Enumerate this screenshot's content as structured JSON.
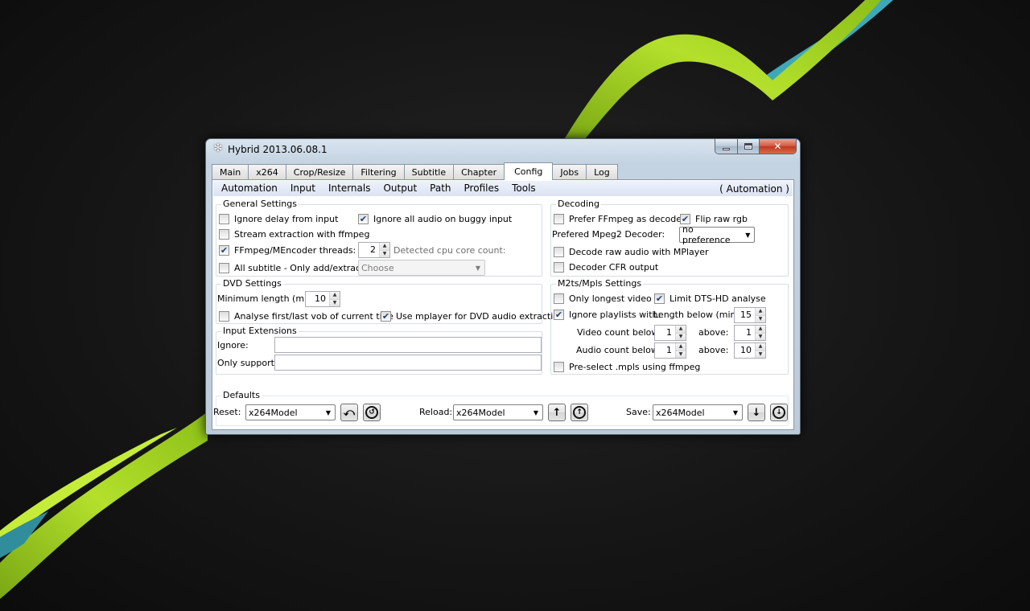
{
  "window": {
    "title": "Hybrid 2013.06.08.1"
  },
  "tabs": [
    {
      "label": "Main"
    },
    {
      "label": "x264"
    },
    {
      "label": "Crop/Resize"
    },
    {
      "label": "Filtering"
    },
    {
      "label": "Subtitle"
    },
    {
      "label": "Chapter"
    },
    {
      "label": "Config",
      "active": true
    },
    {
      "label": "Jobs"
    },
    {
      "label": "Log"
    }
  ],
  "submenu": {
    "items": [
      "Automation",
      "Input",
      "Internals",
      "Output",
      "Path",
      "Profiles",
      "Tools"
    ],
    "current": "( Automation )"
  },
  "general": {
    "title": "General Settings",
    "ignore_delay": {
      "label": "Ignore delay from input",
      "checked": false
    },
    "ignore_audio": {
      "label": "Ignore all audio on buggy input",
      "checked": true
    },
    "stream_extraction": {
      "label": "Stream extraction with ffmpeg",
      "checked": false
    },
    "threads": {
      "label": "FFmpeg/MEncoder threads:",
      "checked": true,
      "value": "2"
    },
    "cpu_cores_label": "Detected cpu core count:",
    "all_subtitle": {
      "label": "All subtitle - Only add/extract:",
      "checked": false,
      "selected": "Choose"
    }
  },
  "decoding": {
    "title": "Decoding",
    "prefer_ffmpeg": {
      "label": "Prefer FFmpeg as decoder",
      "checked": false
    },
    "flip_raw_rgb": {
      "label": "Flip raw rgb",
      "checked": true
    },
    "mpeg2_label": "Prefered Mpeg2 Decoder:",
    "mpeg2_value": "no preference",
    "decode_raw_audio": {
      "label": "Decode raw audio with MPlayer",
      "checked": false
    },
    "decoder_cfr": {
      "label": "Decoder CFR output",
      "checked": false
    }
  },
  "dvd": {
    "title": "DVD Settings",
    "min_length_label": "Minimum length (min):",
    "min_length_value": "10",
    "analyse_vob": {
      "label": "Analyse first/last vob of current title",
      "checked": false
    },
    "use_mplayer": {
      "label": "Use mplayer for DVD audio extraction",
      "checked": true
    }
  },
  "input_ext": {
    "title": "Input Extensions",
    "ignore_label": "Ignore:",
    "ignore_value": "",
    "only_support_label": "Only support:",
    "only_support_value": ""
  },
  "m2ts": {
    "title": "M2ts/Mpls Settings",
    "only_longest": {
      "label": "Only longest video",
      "checked": false
    },
    "limit_dts": {
      "label": "Limit DTS-HD analyse",
      "checked": true
    },
    "ignore_playlists": {
      "label": "Ignore playlists with:",
      "checked": true
    },
    "length_below_label": "Length below (min):",
    "length_below_value": "15",
    "video_count_label": "Video count below:",
    "video_count_value": "1",
    "video_above_label": "above:",
    "video_above_value": "1",
    "audio_count_label": "Audio count below:",
    "audio_count_value": "1",
    "audio_above_label": "above:",
    "audio_above_value": "10",
    "preselect": {
      "label": "Pre-select .mpls using ffmpeg",
      "checked": false
    }
  },
  "defaults": {
    "title": "Defaults",
    "reset_label": "Reset:",
    "reset_value": "x264Model",
    "reload_label": "Reload:",
    "reload_value": "x264Model",
    "save_label": "Save:",
    "save_value": "x264Model"
  },
  "colors": {
    "accent_green": "#9ccc1c",
    "accent_cyan": "#3fa8b8",
    "selection_blue": "#dbe3f3"
  }
}
